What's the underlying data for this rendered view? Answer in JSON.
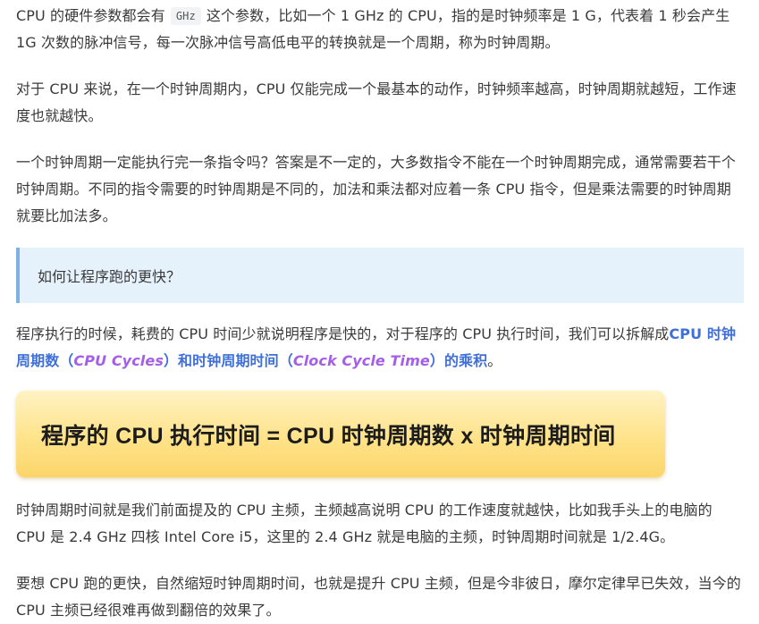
{
  "article": {
    "p1": {
      "before_code": "CPU 的硬件参数都会有",
      "code": "GHz",
      "after_code": "这个参数，比如一个 1 GHz 的 CPU，指的是时钟频率是 1 G，代表着 1 秒会产生 1G 次数的脉冲信号，每一次脉冲信号高低电平的转换就是一个周期，称为时钟周期。"
    },
    "p2": "对于 CPU 来说，在一个时钟周期内，CPU 仅能完成一个最基本的动作，时钟频率越高，时钟周期就越短，工作速度也就越快。",
    "p3": "一个时钟周期一定能执行完一条指令吗？答案是不一定的，大多数指令不能在一个时钟周期完成，通常需要若干个时钟周期。不同的指令需要的时钟周期是不同的，加法和乘法都对应着一条 CPU 指令，但是乘法需要的时钟周期就要比加法多。",
    "blockquote": "如何让程序跑的更快？",
    "p4": {
      "text": "程序执行的时候，耗费的 CPU 时间少就说明程序是快的，对于程序的 CPU 执行时间，我们可以拆解成",
      "strong_1": "CPU 时钟周期数（",
      "em_1": "CPU Cycles",
      "strong_2": "）和时钟周期时间（",
      "em_2": "Clock Cycle Time",
      "strong_3": "）的乘积",
      "tail": "。"
    },
    "formula": "程序的 CPU 执行时间 = CPU 时钟周期数 x 时钟周期时间",
    "p5": "时钟周期时间就是我们前面提及的 CPU 主频，主频越高说明 CPU 的工作速度就越快，比如我手头上的电脑的 CPU 是 2.4 GHz 四核 Intel Core i5，这里的 2.4 GHz 就是电脑的主频，时钟周期时间就是 1/2.4G。",
    "p6": "要想 CPU 跑的更快，自然缩短时钟周期时间，也就是提升 CPU 主频，但是今非彼日，摩尔定律早已失效，当今的 CPU 主频已经很难再做到翻倍的效果了。"
  },
  "colors": {
    "text": "#3a3a3a",
    "strong_blue": "#3f6fd8",
    "em_purple": "#a45ee8",
    "blockquote_bg": "#e6f2fb",
    "blockquote_border": "#7fb1e3",
    "formula_bg": "#ffe38a"
  }
}
